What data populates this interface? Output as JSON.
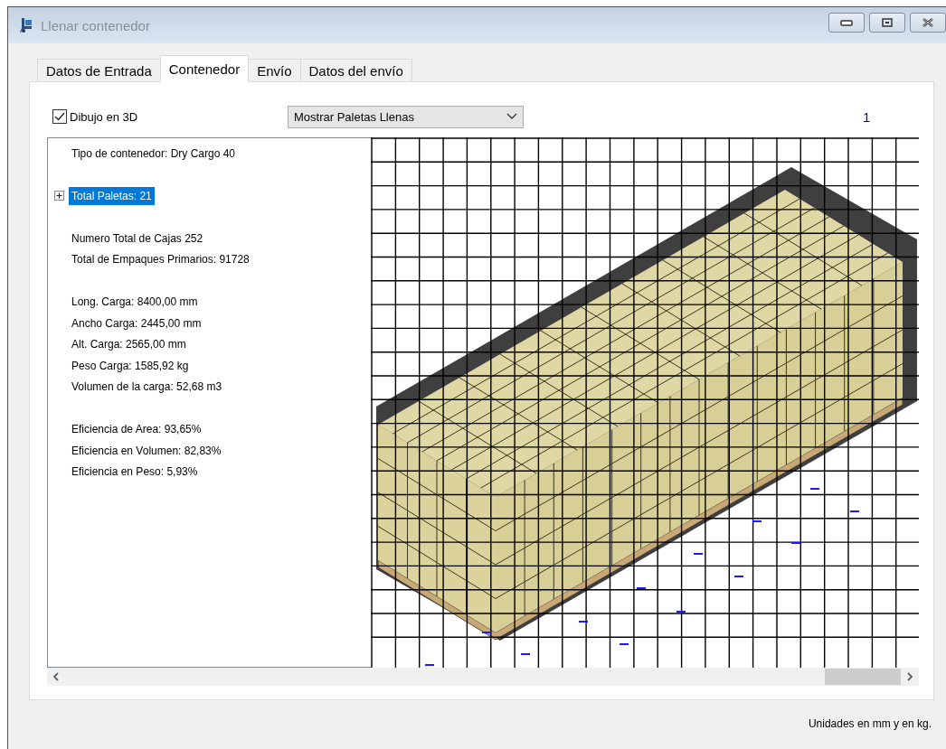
{
  "window": {
    "title": "Llenar contenedor"
  },
  "tabs": [
    {
      "label": "Datos de Entrada",
      "selected": false
    },
    {
      "label": "Contenedor",
      "selected": true
    },
    {
      "label": "Envío",
      "selected": false
    },
    {
      "label": "Datos del envío",
      "selected": false
    }
  ],
  "options": {
    "checkbox": {
      "label": "Dibujo en 3D",
      "checked": true
    },
    "view_select": {
      "value": "Mostrar Paletas Llenas"
    },
    "page_number": "1"
  },
  "summary": {
    "groups": [
      [
        {
          "kind": "text",
          "text": "Tipo de contenedor: Dry Cargo 40"
        }
      ],
      [
        {
          "kind": "node",
          "text": "Total Paletas: 21",
          "expanded": false,
          "selected": true
        }
      ],
      [
        {
          "kind": "text",
          "text": "Numero Total de Cajas 252"
        },
        {
          "kind": "text",
          "text": "Total de Empaques Primarios: 91728"
        }
      ],
      [
        {
          "kind": "text",
          "text": "Long. Carga: 8400,00 mm"
        },
        {
          "kind": "text",
          "text": "Ancho Carga: 2445,00 mm"
        },
        {
          "kind": "text",
          "text": "Alt. Carga: 2565,00 mm"
        },
        {
          "kind": "text",
          "text": "Peso Carga: 1585,92 kg"
        },
        {
          "kind": "text",
          "text": "Volumen de la carga: 52,68 m3"
        }
      ],
      [
        {
          "kind": "text",
          "text": "Eficiencia de Area: 93,65%"
        },
        {
          "kind": "text",
          "text": "Eficiencia en Volumen: 82,83%"
        },
        {
          "kind": "text",
          "text": "Eficiencia en Peso: 5,93%"
        }
      ]
    ]
  },
  "footer_note": "Unidades en mm y en kg."
}
